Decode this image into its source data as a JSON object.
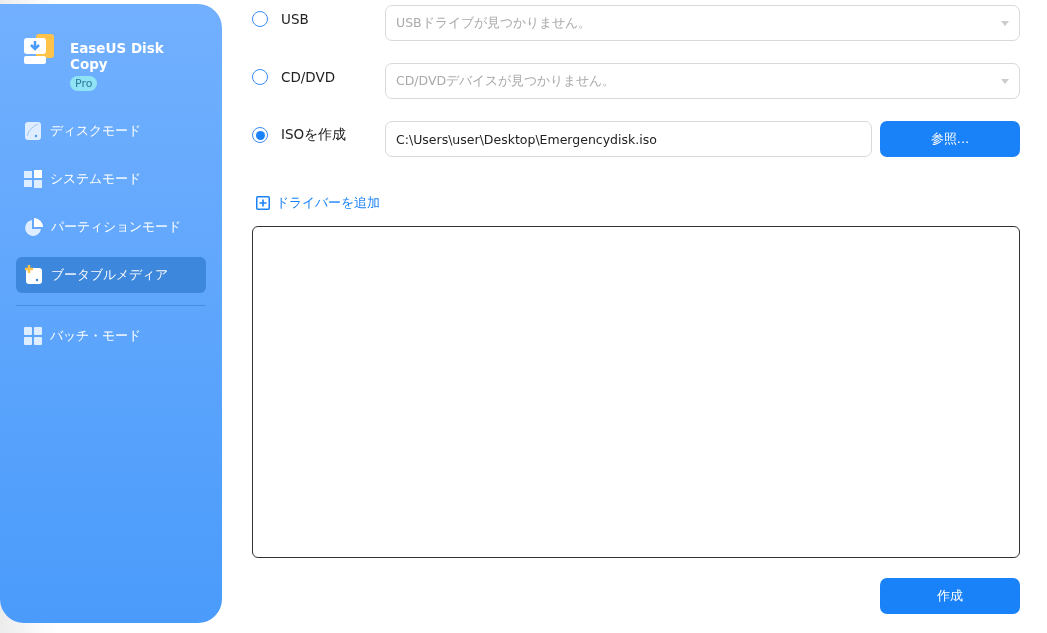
{
  "app": {
    "title": "EaseUS Disk Copy",
    "edition": "Pro"
  },
  "sidebar": {
    "items": [
      {
        "label": "ディスクモード",
        "selected": false
      },
      {
        "label": "システムモード",
        "selected": false
      },
      {
        "label": "パーティションモード",
        "selected": false
      },
      {
        "label": "ブータブルメディア",
        "selected": true
      }
    ],
    "bottom_items": [
      {
        "label": "バッチ・モード",
        "selected": false
      }
    ]
  },
  "targets": [
    {
      "label": "USB",
      "selected": false,
      "kind": "dropdown",
      "placeholder": "USBドライブが見つかりません。"
    },
    {
      "label": "CD/DVD",
      "selected": false,
      "kind": "dropdown",
      "placeholder": "CD/DVDデバイスが見つかりません。"
    },
    {
      "label": "ISOを作成",
      "selected": true,
      "kind": "path",
      "value": "C:\\Users\\user\\Desktop\\Emergencydisk.iso",
      "button": "参照..."
    }
  ],
  "add_driver": "ドライバーを追加",
  "create_button": "作成"
}
